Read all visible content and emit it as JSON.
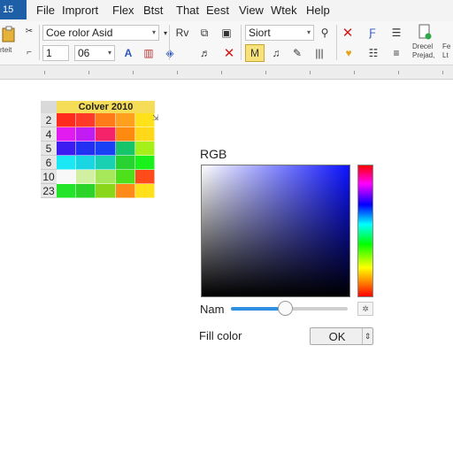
{
  "app": {
    "badge": "15"
  },
  "menu": [
    "File",
    "Imprort",
    "Flex",
    "Btst",
    "That",
    "Eest",
    "View",
    "Wtek",
    "Help"
  ],
  "ribbon": {
    "left_caption": "rteit",
    "font_name": "Coe rolor  Asid",
    "font_size_a": "1",
    "font_size_b": "06",
    "rv_label": "Rv",
    "style_box": "Siort",
    "right_caption_a": "Drecel",
    "right_caption_b": "Prejad,",
    "right_caption_c": "Fe",
    "right_caption_d": "Lt"
  },
  "swatch_table": {
    "title": "Colver 2010",
    "rows": [
      "2",
      "4",
      "5",
      "6",
      "10",
      "23"
    ],
    "colors": [
      [
        "#ff2b1c",
        "#ff3a28",
        "#ff7a18",
        "#ffa01e",
        "#ffe21a"
      ],
      [
        "#e21cf0",
        "#c21cf4",
        "#f4236a",
        "#ff8a12",
        "#ffd81a"
      ],
      [
        "#3c1cf0",
        "#2230f4",
        "#1a40f6",
        "#16c46a",
        "#a6f01a"
      ],
      [
        "#1ae8f4",
        "#1ad6e2",
        "#1ad0b2",
        "#28d230",
        "#1af01a"
      ],
      [
        "#f8f8f8",
        "#d2f0a2",
        "#a6e85a",
        "#4ee01a",
        "#ff4a1a"
      ],
      [
        "#24e42a",
        "#2cd42a",
        "#8ad61a",
        "#ff8a1a",
        "#ffe01a"
      ]
    ]
  },
  "color_picker": {
    "mode_label": "RGB",
    "slider_label": "Nam",
    "slider_value": 0.46,
    "fill_label": "Fill color",
    "ok_label": "OK"
  },
  "colors": {
    "accent": "#2f8fe0",
    "brand": "#1f5fa8",
    "title_fill": "#f6dd58"
  },
  "icons": [
    "paste-icon",
    "bold-icon",
    "fill-icon",
    "font-color-icon",
    "close-x-icon",
    "highlight-icon",
    "music-note-icon",
    "paragraph-icon",
    "heart-icon",
    "list-icon",
    "document-icon",
    "pin-icon"
  ]
}
